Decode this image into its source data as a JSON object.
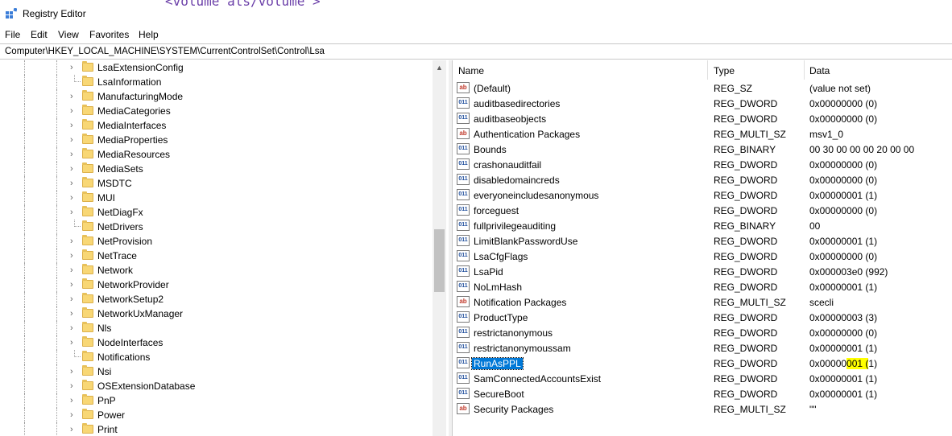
{
  "window": {
    "title": "Registry Editor",
    "overlay_fragment": "<volume als/volume >"
  },
  "menu": [
    "File",
    "Edit",
    "View",
    "Favorites",
    "Help"
  ],
  "address": "Computer\\HKEY_LOCAL_MACHINE\\SYSTEM\\CurrentControlSet\\Control\\Lsa",
  "tree": {
    "items": [
      {
        "label": "LsaExtensionConfig",
        "expandable": true
      },
      {
        "label": "LsaInformation",
        "expandable": false
      },
      {
        "label": "ManufacturingMode",
        "expandable": true
      },
      {
        "label": "MediaCategories",
        "expandable": true
      },
      {
        "label": "MediaInterfaces",
        "expandable": true
      },
      {
        "label": "MediaProperties",
        "expandable": true
      },
      {
        "label": "MediaResources",
        "expandable": true
      },
      {
        "label": "MediaSets",
        "expandable": true
      },
      {
        "label": "MSDTC",
        "expandable": true
      },
      {
        "label": "MUI",
        "expandable": true
      },
      {
        "label": "NetDiagFx",
        "expandable": true
      },
      {
        "label": "NetDrivers",
        "expandable": false
      },
      {
        "label": "NetProvision",
        "expandable": true
      },
      {
        "label": "NetTrace",
        "expandable": true
      },
      {
        "label": "Network",
        "expandable": true
      },
      {
        "label": "NetworkProvider",
        "expandable": true
      },
      {
        "label": "NetworkSetup2",
        "expandable": true
      },
      {
        "label": "NetworkUxManager",
        "expandable": true
      },
      {
        "label": "Nls",
        "expandable": true
      },
      {
        "label": "NodeInterfaces",
        "expandable": true
      },
      {
        "label": "Notifications",
        "expandable": false
      },
      {
        "label": "Nsi",
        "expandable": true
      },
      {
        "label": "OSExtensionDatabase",
        "expandable": true
      },
      {
        "label": "PnP",
        "expandable": true
      },
      {
        "label": "Power",
        "expandable": true
      },
      {
        "label": "Print",
        "expandable": true
      }
    ]
  },
  "list": {
    "columns": {
      "name": "Name",
      "type": "Type",
      "data": "Data"
    },
    "rows": [
      {
        "icon": "ab",
        "name": "(Default)",
        "type": "REG_SZ",
        "data": "(value not set)"
      },
      {
        "icon": "bin",
        "name": "auditbasedirectories",
        "type": "REG_DWORD",
        "data": "0x00000000 (0)"
      },
      {
        "icon": "bin",
        "name": "auditbaseobjects",
        "type": "REG_DWORD",
        "data": "0x00000000 (0)"
      },
      {
        "icon": "ab",
        "name": "Authentication Packages",
        "type": "REG_MULTI_SZ",
        "data": "msv1_0"
      },
      {
        "icon": "bin",
        "name": "Bounds",
        "type": "REG_BINARY",
        "data": "00 30 00 00 00 20 00 00"
      },
      {
        "icon": "bin",
        "name": "crashonauditfail",
        "type": "REG_DWORD",
        "data": "0x00000000 (0)"
      },
      {
        "icon": "bin",
        "name": "disabledomaincreds",
        "type": "REG_DWORD",
        "data": "0x00000000 (0)"
      },
      {
        "icon": "bin",
        "name": "everyoneincludesanonymous",
        "type": "REG_DWORD",
        "data": "0x00000001 (1)"
      },
      {
        "icon": "bin",
        "name": "forceguest",
        "type": "REG_DWORD",
        "data": "0x00000000 (0)"
      },
      {
        "icon": "bin",
        "name": "fullprivilegeauditing",
        "type": "REG_BINARY",
        "data": "00"
      },
      {
        "icon": "bin",
        "name": "LimitBlankPasswordUse",
        "type": "REG_DWORD",
        "data": "0x00000001 (1)"
      },
      {
        "icon": "bin",
        "name": "LsaCfgFlags",
        "type": "REG_DWORD",
        "data": "0x00000000 (0)"
      },
      {
        "icon": "bin",
        "name": "LsaPid",
        "type": "REG_DWORD",
        "data": "0x000003e0 (992)"
      },
      {
        "icon": "bin",
        "name": "NoLmHash",
        "type": "REG_DWORD",
        "data": "0x00000001 (1)"
      },
      {
        "icon": "ab",
        "name": "Notification Packages",
        "type": "REG_MULTI_SZ",
        "data": "scecli"
      },
      {
        "icon": "bin",
        "name": "ProductType",
        "type": "REG_DWORD",
        "data": "0x00000003 (3)"
      },
      {
        "icon": "bin",
        "name": "restrictanonymous",
        "type": "REG_DWORD",
        "data": "0x00000000 (0)"
      },
      {
        "icon": "bin",
        "name": "restrictanonymoussam",
        "type": "REG_DWORD",
        "data": "0x00000001 (1)"
      },
      {
        "icon": "bin",
        "name": "RunAsPPL",
        "type": "REG_DWORD",
        "data": "0x00000001 (1)",
        "selected": true,
        "highlight": "001 (",
        "data_prefix": "0x00000",
        "data_suffix": "1)"
      },
      {
        "icon": "bin",
        "name": "SamConnectedAccountsExist",
        "type": "REG_DWORD",
        "data": "0x00000001 (1)"
      },
      {
        "icon": "bin",
        "name": "SecureBoot",
        "type": "REG_DWORD",
        "data": "0x00000001 (1)"
      },
      {
        "icon": "ab",
        "name": "Security Packages",
        "type": "REG_MULTI_SZ",
        "data": "\"\""
      }
    ]
  },
  "colors": {
    "selection": "#0078d7",
    "highlight": "#ffff00",
    "folder": "#f8d775"
  }
}
